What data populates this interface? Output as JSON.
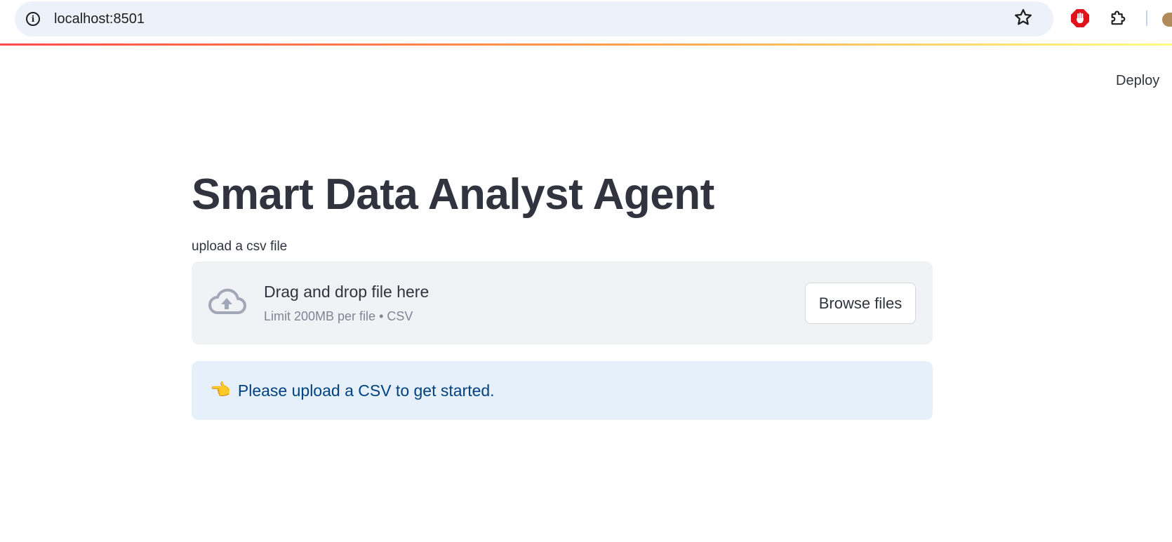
{
  "browser": {
    "url": "localhost:8501",
    "site_info_glyph": "i",
    "icons": {
      "site_info": "info-icon",
      "bookmark": "star-icon",
      "extension_1": "stop-hand-icon",
      "extension_2": "puzzle-icon"
    }
  },
  "header": {
    "deploy_label": "Deploy"
  },
  "main": {
    "title": "Smart Data Analyst Agent",
    "uploader": {
      "label": "upload a csv file",
      "drop_text": "Drag and drop file here",
      "limit_text": "Limit 200MB per file • CSV",
      "browse_label": "Browse files",
      "icon": "cloud-upload-icon"
    },
    "info": {
      "emoji": "👈",
      "text": "Please upload a CSV to get started."
    }
  },
  "colors": {
    "text": "#31333f",
    "dropzone_bg": "#f0f2f6",
    "info_bg": "#e6f0fb",
    "info_text": "#004280",
    "muted_text": "#808495",
    "decoration_start": "#ff4b4b",
    "decoration_end": "#fffd80"
  }
}
